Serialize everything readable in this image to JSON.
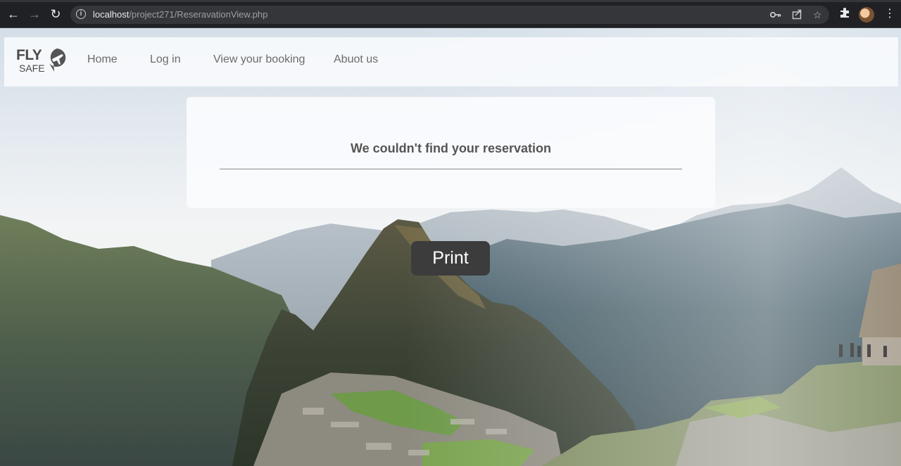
{
  "browser": {
    "url_host": "localhost",
    "url_path": "/project271/ReseravationView.php"
  },
  "navbar": {
    "logo_line1": "FLY",
    "logo_line2": "SAFE",
    "links": [
      {
        "label": "Home"
      },
      {
        "label": "Log in"
      },
      {
        "label": "View your booking"
      },
      {
        "label": "Abuot us"
      }
    ]
  },
  "main": {
    "message": "We couldn't find your reservation",
    "print_label": "Print"
  },
  "colors": {
    "chrome_bg": "#202124",
    "navbar_bg": "#f8fafc",
    "button_bg": "#3c3c3c",
    "text_gray": "#555555"
  }
}
